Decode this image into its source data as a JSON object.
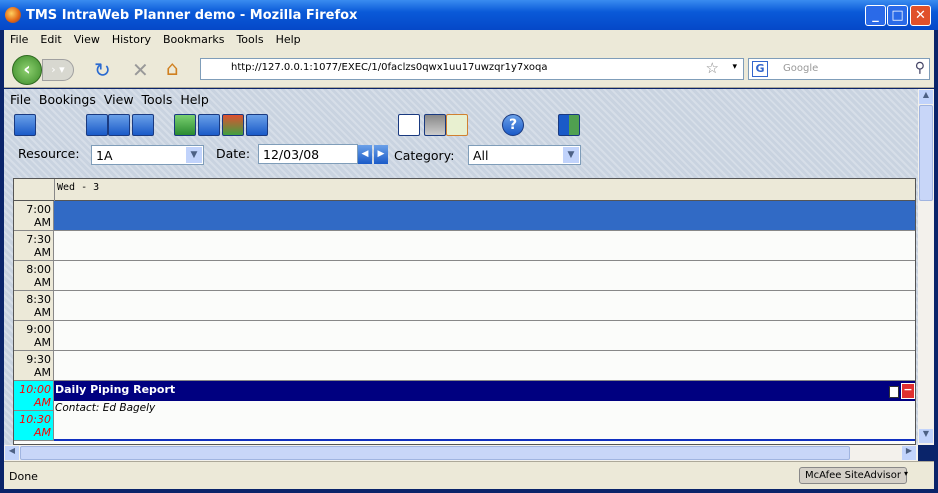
{
  "window": {
    "title": "TMS IntraWeb Planner demo - Mozilla Firefox"
  },
  "browser_menu": [
    "File",
    "Edit",
    "View",
    "History",
    "Bookmarks",
    "Tools",
    "Help"
  ],
  "url": "http://127.0.0.1:1077/EXEC/1/0faclzs0qwx1uu17uwzqr1y7xoqa",
  "search_placeholder": "Google",
  "app_menu": [
    "File",
    "Bookings",
    "View",
    "Tools",
    "Help"
  ],
  "filters": {
    "resource_label": "Resource:",
    "resource_value": "1A",
    "date_label": "Date:",
    "date_value": "12/03/08",
    "category_label": "Category:",
    "category_value": "All"
  },
  "planner": {
    "day_header": "Wed - 3",
    "slots": [
      {
        "h": "7:00",
        "ap": "AM"
      },
      {
        "h": "7:30",
        "ap": "AM"
      },
      {
        "h": "8:00",
        "ap": "AM"
      },
      {
        "h": "8:30",
        "ap": "AM"
      },
      {
        "h": "9:00",
        "ap": "AM"
      },
      {
        "h": "9:30",
        "ap": "AM"
      },
      {
        "h": "10:00",
        "ap": "AM"
      },
      {
        "h": "10:30",
        "ap": "AM"
      }
    ],
    "event": {
      "title": "Daily Piping Report",
      "contact": "Contact: Ed Bagely"
    }
  },
  "status": {
    "text": "Done",
    "addon": "McAfee SiteAdvisor"
  }
}
